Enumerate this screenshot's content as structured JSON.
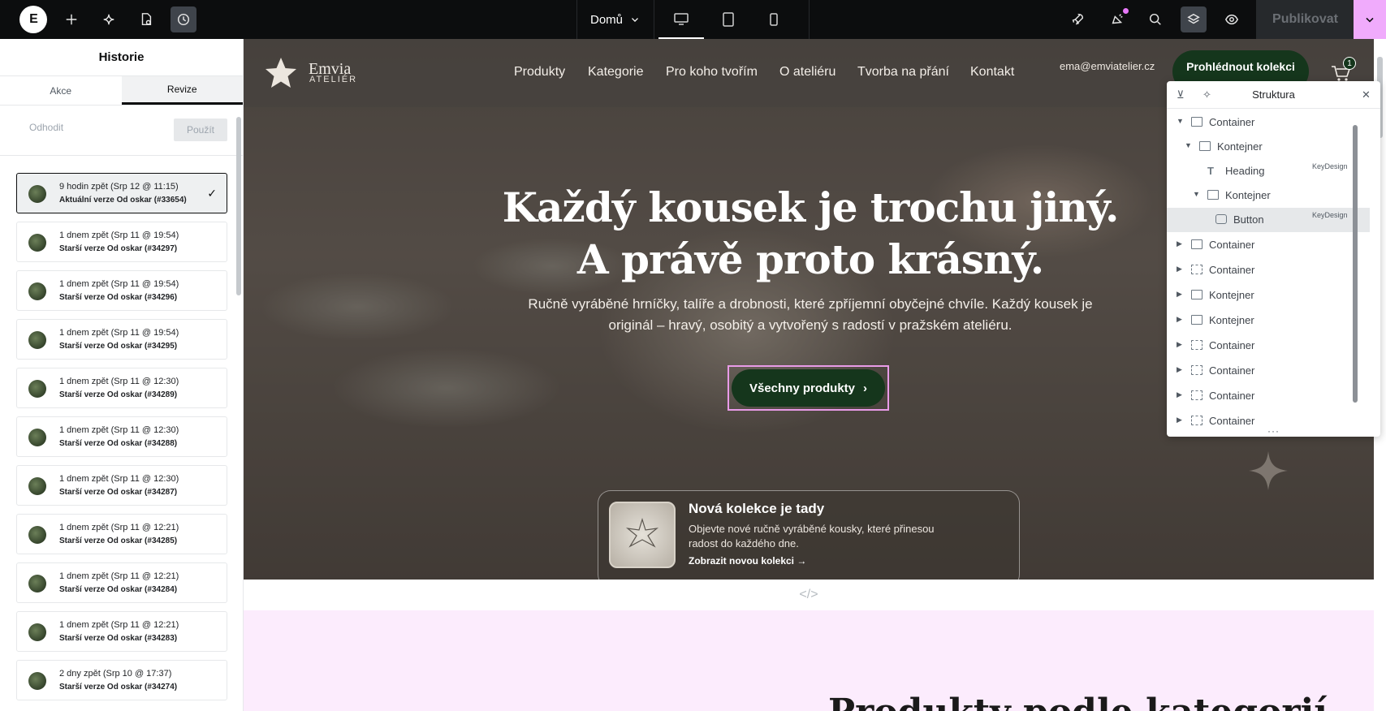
{
  "topbar": {
    "logo": "E",
    "page_selector": "Domů",
    "publish_label": "Publikovat"
  },
  "history_panel": {
    "title": "Historie",
    "tabs": [
      {
        "label": "Akce",
        "active": false
      },
      {
        "label": "Revize",
        "active": true
      }
    ],
    "discard_label": "Odhodit",
    "apply_label": "Použít",
    "revisions": [
      {
        "when": "9 hodin zpět (Srp 12 @ 11:15)",
        "desc": "Aktuální verze Od oskar (#33654)",
        "current": true
      },
      {
        "when": "1 dnem zpět (Srp 11 @ 19:54)",
        "desc": "Starší verze Od oskar (#34297)",
        "current": false
      },
      {
        "when": "1 dnem zpět (Srp 11 @ 19:54)",
        "desc": "Starší verze Od oskar (#34296)",
        "current": false
      },
      {
        "when": "1 dnem zpět (Srp 11 @ 19:54)",
        "desc": "Starší verze Od oskar (#34295)",
        "current": false
      },
      {
        "when": "1 dnem zpět (Srp 11 @ 12:30)",
        "desc": "Starší verze Od oskar (#34289)",
        "current": false
      },
      {
        "when": "1 dnem zpět (Srp 11 @ 12:30)",
        "desc": "Starší verze Od oskar (#34288)",
        "current": false
      },
      {
        "when": "1 dnem zpět (Srp 11 @ 12:30)",
        "desc": "Starší verze Od oskar (#34287)",
        "current": false
      },
      {
        "when": "1 dnem zpět (Srp 11 @ 12:21)",
        "desc": "Starší verze Od oskar (#34285)",
        "current": false
      },
      {
        "when": "1 dnem zpět (Srp 11 @ 12:21)",
        "desc": "Starší verze Od oskar (#34284)",
        "current": false
      },
      {
        "when": "1 dnem zpět (Srp 11 @ 12:21)",
        "desc": "Starší verze Od oskar (#34283)",
        "current": false
      },
      {
        "when": "2 dny zpět (Srp 10 @ 17:37)",
        "desc": "Starší verze Od oskar (#34274)",
        "current": false
      }
    ]
  },
  "site": {
    "logo_name": "Emvia",
    "logo_sub": "ATELIÉR",
    "nav": [
      "Produkty",
      "Kategorie",
      "Pro koho tvořím",
      "O ateliéru",
      "Tvorba na přání",
      "Kontakt"
    ],
    "email": "ema@emviatelier.cz",
    "cta_label": "Prohlédnout kolekci",
    "cart_count": "1",
    "hero_title_1": "Každý kousek je trochu jiný.",
    "hero_title_2": "A právě proto krásný.",
    "hero_text": "Ručně vyráběné hrníčky, talíře a drobnosti, které zpříjemní obyčejné chvíle. Každý kousek je originál – hravý, osobitý a vytvořený s radostí v pražském ateliéru.",
    "hero_button": "Všechny produkty",
    "promo_title": "Nová kolekce je tady",
    "promo_text": "Objevte nové ručně vyráběné kousky, které přinesou radost do každého dne.",
    "promo_link": "Zobrazit novou kolekci",
    "promo_link_arrow": "→",
    "section_heading": "Produkty podle kategorií"
  },
  "navigator": {
    "title": "Struktura",
    "footer": "···",
    "rows": [
      {
        "label": "Container",
        "level": 0,
        "caret": "down",
        "icon": "solid",
        "tag": "",
        "selected": false
      },
      {
        "label": "Kontejner",
        "level": 1,
        "caret": "down",
        "icon": "solid",
        "tag": "",
        "selected": false
      },
      {
        "label": "Heading",
        "level": 2,
        "caret": "none",
        "icon": "heading",
        "tag": "KeyDesign",
        "selected": false
      },
      {
        "label": "Kontejner",
        "level": 2,
        "caret": "down",
        "icon": "solid",
        "tag": "",
        "selected": false
      },
      {
        "label": "Button",
        "level": 3,
        "caret": "none",
        "icon": "button",
        "tag": "KeyDesign",
        "selected": true
      },
      {
        "label": "Container",
        "level": 0,
        "caret": "right",
        "icon": "solid",
        "tag": "",
        "selected": false
      },
      {
        "label": "Container",
        "level": 0,
        "caret": "right",
        "icon": "dash",
        "tag": "",
        "selected": false
      },
      {
        "label": "Kontejner",
        "level": 0,
        "caret": "right",
        "icon": "solid",
        "tag": "",
        "selected": false
      },
      {
        "label": "Kontejner",
        "level": 0,
        "caret": "right",
        "icon": "solid",
        "tag": "",
        "selected": false
      },
      {
        "label": "Container",
        "level": 0,
        "caret": "right",
        "icon": "dash",
        "tag": "",
        "selected": false
      },
      {
        "label": "Container",
        "level": 0,
        "caret": "right",
        "icon": "dash",
        "tag": "",
        "selected": false
      },
      {
        "label": "Container",
        "level": 0,
        "caret": "right",
        "icon": "dash",
        "tag": "",
        "selected": false
      },
      {
        "label": "Container",
        "level": 0,
        "caret": "right",
        "icon": "dash",
        "tag": "",
        "selected": false
      }
    ]
  },
  "colors": {
    "topbar_bg": "#0c0d0e",
    "accent_pink": "#f0abfc",
    "brand_green": "#15361c",
    "pink_section": "#fcecfd"
  },
  "icons": [
    "elementor-logo-icon",
    "plus-icon",
    "ai-sparkle-icon",
    "page-settings-icon",
    "history-icon",
    "chevron-down-icon",
    "desktop-icon",
    "tablet-icon",
    "mobile-icon",
    "rocket-icon",
    "notifications-icon",
    "search-icon",
    "layers-icon",
    "preview-eye-icon",
    "cart-icon",
    "star-logo-icon",
    "check-icon"
  ]
}
